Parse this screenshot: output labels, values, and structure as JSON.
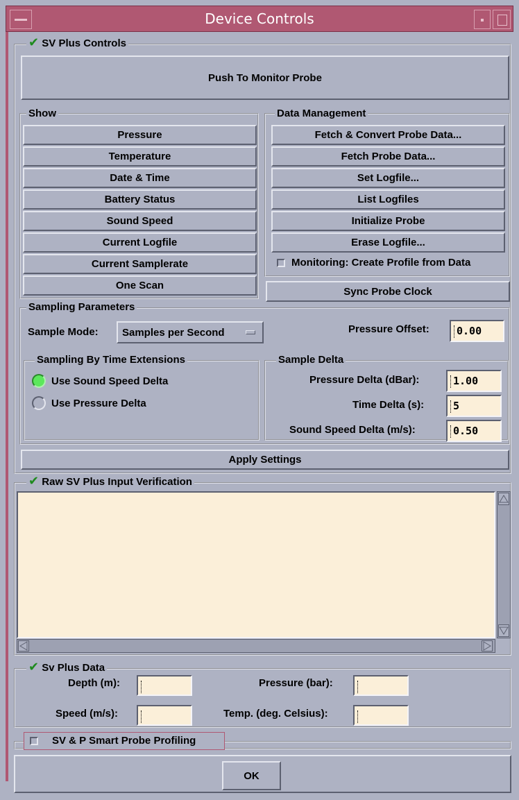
{
  "window": {
    "title": "Device Controls"
  },
  "sv_controls": {
    "label": "SV Plus Controls",
    "checked": true,
    "monitor_button": "Push To Monitor Probe"
  },
  "show": {
    "label": "Show",
    "buttons": [
      "Pressure",
      "Temperature",
      "Date & Time",
      "Battery Status",
      "Sound Speed",
      "Current Logfile",
      "Current Samplerate",
      "One Scan"
    ]
  },
  "data_management": {
    "label": "Data Management",
    "buttons": [
      "Fetch & Convert Probe Data...",
      "Fetch Probe Data...",
      "Set Logfile...",
      "List Logfiles",
      "Initialize Probe",
      "Erase Logfile..."
    ],
    "monitoring_checkbox": "Monitoring: Create Profile from Data",
    "monitoring_checked": false,
    "sync_button": "Sync Probe Clock"
  },
  "sampling": {
    "label": "Sampling Parameters",
    "mode_label": "Sample Mode:",
    "mode_value": "Samples per Second",
    "pressure_offset_label": "Pressure Offset:",
    "pressure_offset_value": "0.00",
    "extensions": {
      "label": "Sampling By Time Extensions",
      "options": [
        "Use Sound Speed Delta",
        "Use Pressure Delta"
      ],
      "selected": "Use Sound Speed Delta"
    },
    "delta": {
      "label": "Sample Delta",
      "pressure_delta_label": "Pressure Delta (dBar):",
      "pressure_delta_value": "1.00",
      "time_delta_label": "Time Delta (s):",
      "time_delta_value": "5",
      "sound_speed_delta_label": "Sound Speed Delta (m/s):",
      "sound_speed_delta_value": "0.50"
    },
    "apply_button": "Apply Settings"
  },
  "raw_input": {
    "label": "Raw SV Plus Input Verification",
    "checked": true,
    "text": ""
  },
  "sv_data": {
    "label": "Sv Plus Data",
    "checked": true,
    "depth_label": "Depth (m):",
    "depth_value": "",
    "pressure_label": "Pressure (bar):",
    "pressure_value": "",
    "speed_label": "Speed (m/s):",
    "speed_value": "",
    "temp_label": "Temp. (deg. Celsius):",
    "temp_value": ""
  },
  "smart_probe": {
    "label": "SV & P Smart Probe Profiling",
    "checked": false
  },
  "ok_button": "OK",
  "colors": {
    "background": "#aeb2c3",
    "titlebar": "#b05872",
    "check_green": "#1e8a1e",
    "radio_on": "#5ce85c",
    "field_bg": "#fbefd9"
  }
}
